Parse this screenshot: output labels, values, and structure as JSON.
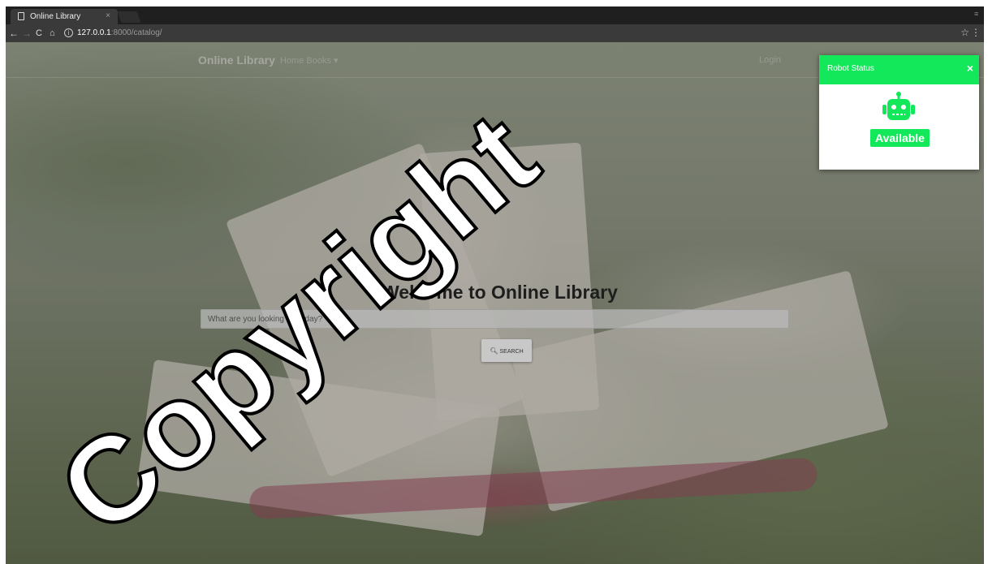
{
  "browser": {
    "tab_title": "Online Library",
    "tab_close": "×",
    "url_host": "127.0.0.1",
    "url_rest": ":8000/catalog/"
  },
  "site": {
    "brand": "Online Library",
    "nav_menu": "Home   Books ▾",
    "nav_right": "Login"
  },
  "hero": {
    "title": "Welcome to Online Library",
    "search_placeholder": "What are you looking for today?",
    "search_button": "SEARCH"
  },
  "robot_status": {
    "title": "Robot Status",
    "close": "×",
    "status": "Available",
    "accent_color": "#13e85a"
  },
  "watermark": {
    "text": "Copyright"
  }
}
